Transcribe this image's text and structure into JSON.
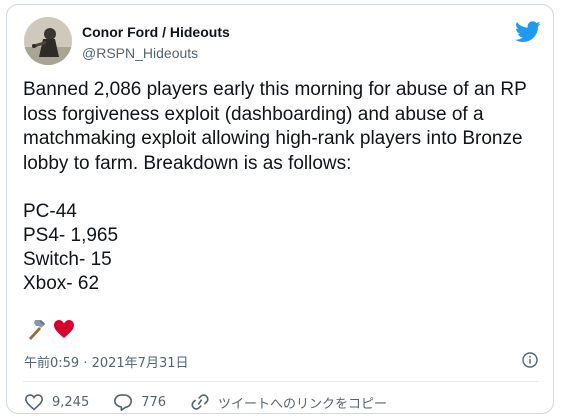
{
  "author": {
    "name": "Conor Ford / Hideouts",
    "handle": "@RSPN_Hideouts"
  },
  "tweet": {
    "text": "Banned 2,086 players early this morning for abuse of an RP loss forgiveness exploit (dashboarding) and abuse of a matchmaking exploit allowing high-rank players into Bronze lobby to farm. Breakdown is as follows:",
    "breakdown": [
      "PC-44",
      "PS4- 1,965",
      "Switch- 15",
      "Xbox- 62"
    ],
    "emojis": [
      "hammer-emoji",
      "heart-emoji"
    ],
    "timestamp": "午前0:59 · 2021年7月31日"
  },
  "actions": {
    "likes": "9,245",
    "replies": "776",
    "copy_link_label": "ツイートへのリンクをコピー"
  },
  "colors": {
    "brand": "#1d9bf0",
    "text": "#0f1419",
    "muted": "#536471",
    "heart": "#d5002b"
  },
  "icons": [
    "twitter-bird-icon",
    "info-icon",
    "like-icon",
    "reply-icon",
    "link-icon"
  ]
}
